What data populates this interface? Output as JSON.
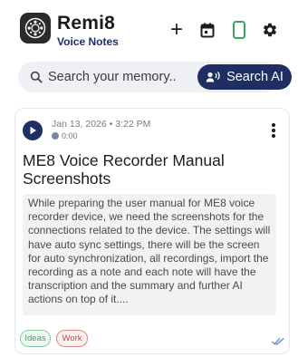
{
  "app": {
    "title": "Remi8",
    "subtitle": "Voice Notes",
    "icons": [
      "logo-icon",
      "plus-icon",
      "calendar-icon",
      "phone-icon",
      "gear-icon"
    ]
  },
  "search": {
    "placeholder": "Search your memory..",
    "ai_button_label": "Search AI"
  },
  "note": {
    "date": "Jan 13, 2026 • 3:22 PM",
    "duration": "0:00",
    "title": "ME8 Voice Recorder Manual Screenshots",
    "body": "While preparing the user manual for ME8 voice recorder device, we need the screenshots for the connections related to the device. The settings will have auto sync settings, there will be the screen for auto synchronization, all recordings, import the recording as a note and each note will have the transcription and the summary and further AI actions on top of it....",
    "tags": [
      "Ideas",
      "Work"
    ]
  },
  "colors": {
    "brand_navy": "#1f2f63",
    "phone_green": "#3aa35b",
    "tag_ideas": "#4a9a6e",
    "tag_work": "#b45454",
    "sync_check": "#6b8fd6"
  }
}
